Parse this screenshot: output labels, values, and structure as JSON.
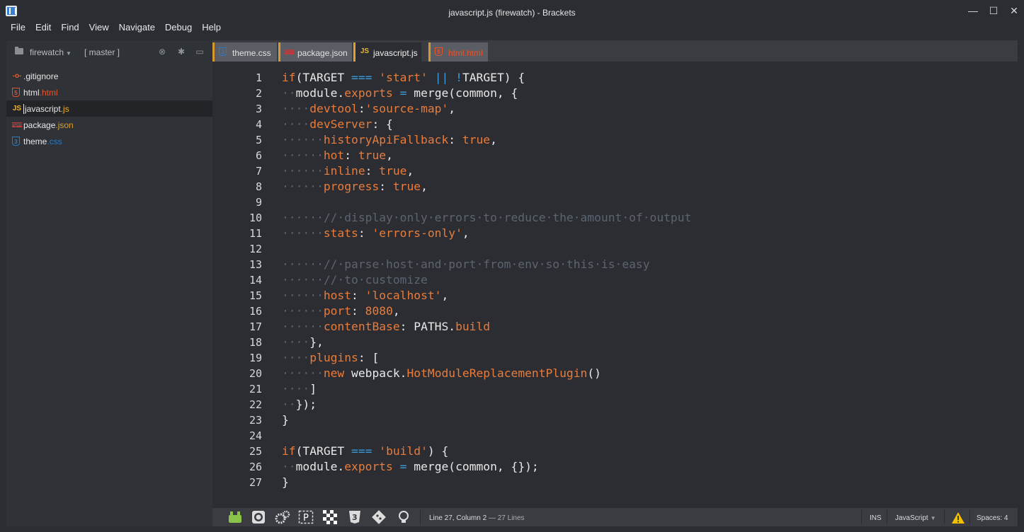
{
  "window": {
    "title": "javascript.js (firewatch) - Brackets",
    "minimize": "—",
    "maximize": "☐",
    "close": "✕"
  },
  "menu": [
    "File",
    "Edit",
    "Find",
    "View",
    "Navigate",
    "Debug",
    "Help"
  ],
  "sidebar": {
    "project_name": "firewatch",
    "branch": "[ master ]",
    "files": [
      {
        "icon": "git-icon",
        "icon_glyph": "-o-",
        "icon_color": "#e0602c",
        "base": ".gitignore",
        "ext": "",
        "ext_color": "#e8e8e8",
        "selected": false
      },
      {
        "icon": "html5-icon",
        "icon_glyph": "5",
        "icon_color": "#e5532d",
        "base": "html",
        "ext": ".html",
        "ext_color": "#e5532d",
        "selected": false
      },
      {
        "icon": "js-icon",
        "icon_glyph": "JS",
        "icon_color": "#f0b429",
        "base": "javascript",
        "ext": ".js",
        "ext_color": "#f0b429",
        "selected": true
      },
      {
        "icon": "npm-icon",
        "icon_glyph": "npm",
        "icon_color": "#c33a3a",
        "base": "package",
        "ext": ".json",
        "ext_color": "#e0a020",
        "selected": false
      },
      {
        "icon": "css3-icon",
        "icon_glyph": "3",
        "icon_color": "#2a7ac9",
        "base": "theme",
        "ext": ".css",
        "ext_color": "#2a7ac9",
        "selected": false
      }
    ]
  },
  "tabs": [
    {
      "icon": "css3-icon",
      "glyph": "3",
      "color": "#2a7ac9",
      "label": "theme.css",
      "active": false
    },
    {
      "icon": "npm-icon",
      "glyph": "npm",
      "color": "#c33a3a",
      "label": "package.json",
      "active": false
    },
    {
      "icon": "js-icon",
      "glyph": "JS",
      "color": "#f0b429",
      "label": "javascript.js",
      "active": true
    },
    {
      "icon": "html5-icon",
      "glyph": "5",
      "color": "#e5532d",
      "label": "html.html",
      "active": false
    }
  ],
  "code_lines": [
    "if(TARGET === 'start' || !TARGET) {",
    "··module.exports = merge(common, {",
    "····devtool:'source-map',",
    "····devServer: {",
    "······historyApiFallback: true,",
    "······hot: true,",
    "······inline: true,",
    "······progress: true,",
    "",
    "······//·display·only·errors·to·reduce·the·amount·of·output",
    "······stats: 'errors-only',",
    "",
    "······//·parse·host·and·port·from·env·so·this·is·easy",
    "······//·to·customize",
    "······host: 'localhost',",
    "······port: 8080,",
    "······contentBase: PATHS.build",
    "····},",
    "····plugins: [",
    "······new webpack.HotModuleReplacementPlugin()",
    "····]",
    "··});",
    "}",
    "",
    "if(TARGET === 'build') {",
    "··module.exports = merge(common, {});",
    "}"
  ],
  "status": {
    "cursor": "Line 27, Column 2",
    "lines": "— 27 Lines",
    "mode": "INS",
    "language": "JavaScript",
    "spaces": "Spaces: 4",
    "extension_icons": [
      "android-icon",
      "camera-icon",
      "gears-icon",
      "p-icon",
      "checker-icon",
      "css3-icon",
      "git-icon",
      "lightbulb-icon"
    ]
  },
  "colors": {
    "keyword": "#e87c3b",
    "operator": "#3d9ad6",
    "comment": "#5c6470",
    "text": "#e8e8e8",
    "background": "#2b2d33",
    "warning": "#f2c200"
  }
}
